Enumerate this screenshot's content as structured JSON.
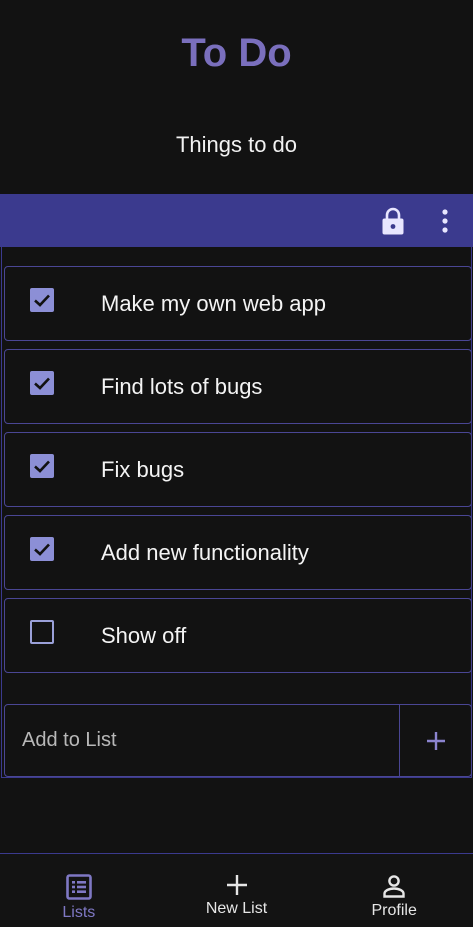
{
  "app": {
    "title": "To Do",
    "list_name": "Things to do"
  },
  "toolbar": {
    "lock_icon": "lock-icon",
    "menu_icon": "more-vertical-icon"
  },
  "items": [
    {
      "label": "Make my own web app",
      "checked": true
    },
    {
      "label": "Find lots of bugs",
      "checked": true
    },
    {
      "label": "Fix bugs",
      "checked": true
    },
    {
      "label": "Add new functionality",
      "checked": true
    },
    {
      "label": "Show off",
      "checked": false
    }
  ],
  "add": {
    "placeholder": "Add to List",
    "value": "",
    "button_icon": "plus-icon"
  },
  "nav": {
    "items": [
      {
        "label": "Lists",
        "icon": "list-icon",
        "active": true
      },
      {
        "label": "New List",
        "icon": "plus-icon",
        "active": false
      },
      {
        "label": "Profile",
        "icon": "person-icon",
        "active": false
      }
    ]
  },
  "colors": {
    "accent": "#7a6fbd",
    "toolbar": "#3b3a8e",
    "border": "#4a4694",
    "background": "#121212",
    "checkbox": "#8c8fd6"
  }
}
